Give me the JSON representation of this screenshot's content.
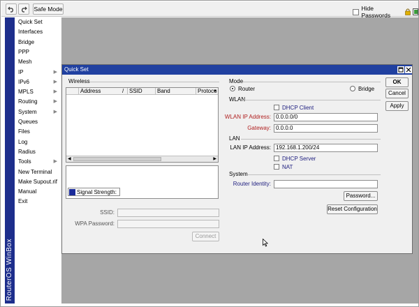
{
  "toolbar": {
    "undo_icon": "undo-icon",
    "redo_icon": "redo-icon",
    "safe_mode_label": "Safe Mode",
    "hide_passwords_label": "Hide Passwords",
    "status_color": "#3a9a3a"
  },
  "brand": {
    "text": "RouterOS WinBox",
    "color": "#1d2e8c"
  },
  "sidebar": {
    "items": [
      {
        "label": "Quick Set",
        "submenu": false
      },
      {
        "label": "Interfaces",
        "submenu": false
      },
      {
        "label": "Bridge",
        "submenu": false
      },
      {
        "label": "PPP",
        "submenu": false
      },
      {
        "label": "Mesh",
        "submenu": false
      },
      {
        "label": "IP",
        "submenu": true
      },
      {
        "label": "IPv6",
        "submenu": true
      },
      {
        "label": "MPLS",
        "submenu": true
      },
      {
        "label": "Routing",
        "submenu": true
      },
      {
        "label": "System",
        "submenu": true
      },
      {
        "label": "Queues",
        "submenu": false
      },
      {
        "label": "Files",
        "submenu": false
      },
      {
        "label": "Log",
        "submenu": false
      },
      {
        "label": "Radius",
        "submenu": false
      },
      {
        "label": "Tools",
        "submenu": true
      },
      {
        "label": "New Terminal",
        "submenu": false
      },
      {
        "label": "Make Supout.rif",
        "submenu": false
      },
      {
        "label": "Manual",
        "submenu": false
      },
      {
        "label": "Exit",
        "submenu": false
      }
    ]
  },
  "dialog": {
    "title": "Quick Set",
    "title_color": "#2040a0",
    "wireless": {
      "section_label": "Wireless",
      "columns": [
        "Address",
        "/",
        "SSID",
        "Band",
        "Protoco"
      ],
      "signal_label": "Signal Strength:",
      "ssid_label": "SSID:",
      "wpa_label": "WPA Password:",
      "ssid_value": "",
      "wpa_value": "",
      "connect_label": "Connect"
    },
    "mode": {
      "section_label": "Mode",
      "router_label": "Router",
      "bridge_label": "Bridge",
      "selected": "Router"
    },
    "wlan": {
      "section_label": "WLAN",
      "dhcp_client_label": "DHCP Client",
      "ip_label": "WLAN IP Address:",
      "ip_value": "0.0.0.0/0",
      "gateway_label": "Gateway:",
      "gateway_value": "0.0.0.0"
    },
    "lan": {
      "section_label": "LAN",
      "ip_label": "LAN IP Address:",
      "ip_value": "192.168.1.200/24",
      "dhcp_server_label": "DHCP Server",
      "nat_label": "NAT"
    },
    "system": {
      "section_label": "System",
      "identity_label": "Router Identity:",
      "identity_value": "",
      "password_label": "Password...",
      "reset_label": "Reset Configuration"
    },
    "buttons": {
      "ok": "OK",
      "cancel": "Cancel",
      "apply": "Apply"
    }
  }
}
